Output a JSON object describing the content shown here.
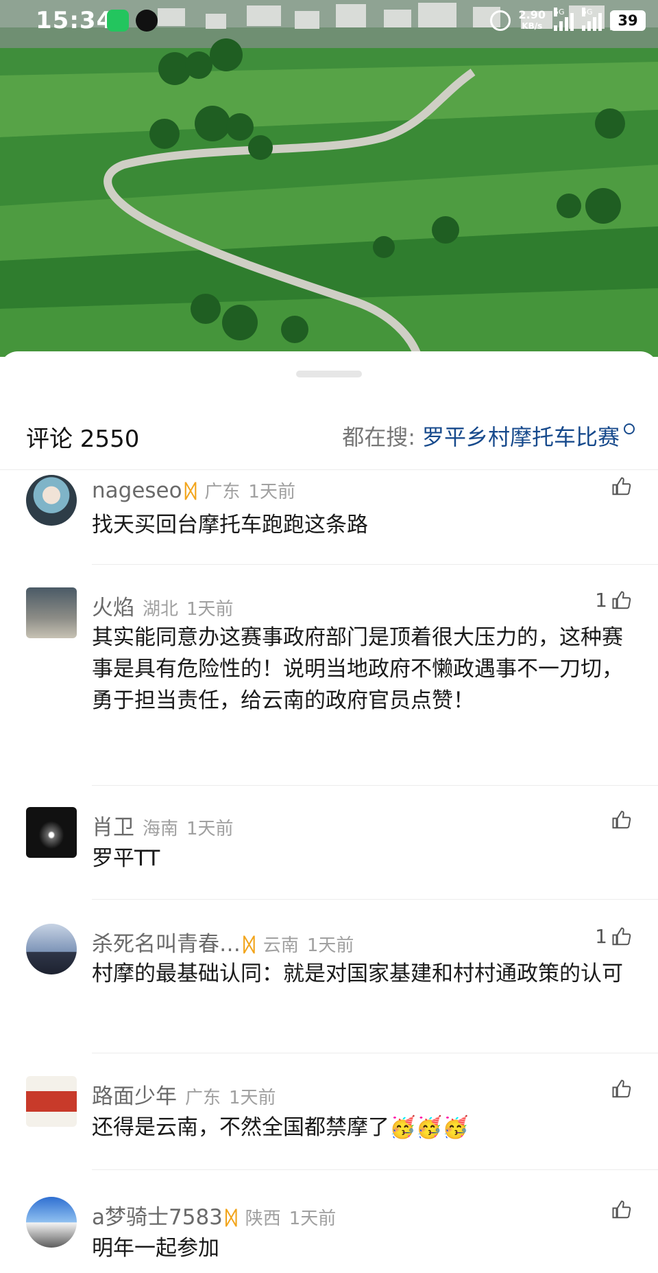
{
  "status_bar": {
    "time": "15:34",
    "net_speed_value": "2.90",
    "net_speed_unit": "KB/s",
    "signal_1": "5G",
    "signal_2": "5G",
    "battery": "39",
    "icons": [
      "wechat-icon",
      "qq-icon",
      "alarm-icon",
      "signal-icon",
      "battery-icon"
    ]
  },
  "comments_header": {
    "count_label": "评论 2550",
    "hot_search_label": "都在搜:",
    "hot_search_term": "罗平乡村摩托车比赛"
  },
  "colors": {
    "accent_link": "#174a8c",
    "vip": "#f2a51c",
    "muted": "#a0a0a0"
  },
  "comments": [
    {
      "user": "nageseo",
      "vip": true,
      "location": "广东",
      "time": "1天前",
      "likes": "",
      "text": "找天买回台摩托车跑跑这条路"
    },
    {
      "user": "火焰",
      "vip": false,
      "location": "湖北",
      "time": "1天前",
      "likes": "1",
      "text": "其实能同意办这赛事政府部门是顶着很大压力的，这种赛事是具有危险性的！说明当地政府不懒政遇事不一刀切，勇于担当责任，给云南的政府官员点赞！"
    },
    {
      "user": "肖卫",
      "vip": false,
      "location": "海南",
      "time": "1天前",
      "likes": "",
      "text": "罗平TT"
    },
    {
      "user": "杀死名叫青春…",
      "vip": true,
      "location": "云南",
      "time": "1天前",
      "likes": "1",
      "text": "村摩的最基础认同：就是对国家基建和村村通政策的认可"
    },
    {
      "user": "路面少年",
      "vip": false,
      "location": "广东",
      "time": "1天前",
      "likes": "",
      "text": "还得是云南，不然全国都禁摩了🥳🥳🥳"
    },
    {
      "user": "a梦骑士7583",
      "vip": true,
      "location": "陕西",
      "time": "1天前",
      "likes": "",
      "text": "明年一起参加"
    }
  ]
}
